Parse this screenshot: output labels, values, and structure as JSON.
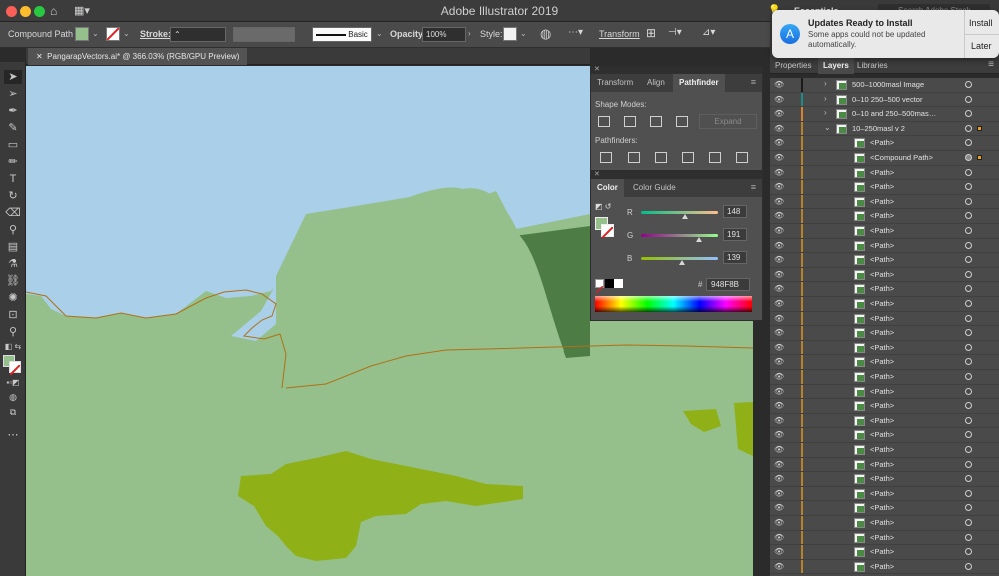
{
  "app": {
    "title": "Adobe Illustrator 2019"
  },
  "workspace": {
    "label": "Essentials"
  },
  "search": {
    "placeholder": "Search Adobe Stock"
  },
  "control_bar": {
    "selection_type": "Compound Path",
    "fill_color": "#95c08b",
    "stroke_label": "Stroke:",
    "brush_label": "Basic",
    "opacity_label": "Opacity:",
    "opacity_value": "100%",
    "style_label": "Style:",
    "transform_label": "Transform"
  },
  "document_tab": {
    "label": "PangarapVectors.ai* @ 366.03% (RGB/GPU Preview)"
  },
  "pathfinder_panel": {
    "tabs": [
      "Transform",
      "Align",
      "Pathfinder"
    ],
    "active_tab": "Pathfinder",
    "shape_modes_label": "Shape Modes:",
    "expand_label": "Expand",
    "pathfinders_label": "Pathfinders:"
  },
  "color_panel": {
    "tabs": [
      "Color",
      "Color Guide"
    ],
    "active_tab": "Color",
    "r_label": "R",
    "r_value": "148",
    "g_label": "G",
    "g_value": "191",
    "b_label": "B",
    "b_value": "139",
    "hex_prefix": "#",
    "hex_value": "948F8B",
    "swatch_color": "#95c08b"
  },
  "notification": {
    "title": "Updates Ready to Install",
    "body": "Some apps could not be updated automatically.",
    "install_label": "Install",
    "later_label": "Later"
  },
  "layers_panel": {
    "tabs": [
      "Properties",
      "Layers",
      "Libraries"
    ],
    "active_tab": "Layers",
    "rows": [
      {
        "name": "500–1000masl Image",
        "color": "#1a1a1a",
        "arrow": "›"
      },
      {
        "name": "0–10 250–500 vector",
        "color": "#1f8a8a",
        "arrow": "›"
      },
      {
        "name": "0–10 and 250–500mas…",
        "color": "#d9822b",
        "arrow": "›"
      },
      {
        "name": "10–250masl v 2",
        "color": "#b8822b",
        "arrow": "⌄"
      },
      {
        "name": "<Path>"
      },
      {
        "name": "<Compound Path>"
      },
      {
        "name": "<Path>"
      },
      {
        "name": "<Path>"
      },
      {
        "name": "<Path>"
      },
      {
        "name": "<Path>"
      },
      {
        "name": "<Path>"
      },
      {
        "name": "<Path>"
      },
      {
        "name": "<Path>"
      },
      {
        "name": "<Path>"
      },
      {
        "name": "<Path>"
      },
      {
        "name": "<Path>"
      },
      {
        "name": "<Path>"
      },
      {
        "name": "<Path>"
      },
      {
        "name": "<Path>"
      },
      {
        "name": "<Path>"
      },
      {
        "name": "<Path>"
      },
      {
        "name": "<Path>"
      },
      {
        "name": "<Path>"
      },
      {
        "name": "<Path>"
      },
      {
        "name": "<Path>"
      },
      {
        "name": "<Path>"
      },
      {
        "name": "<Path>"
      },
      {
        "name": "<Path>"
      },
      {
        "name": "<Path>"
      },
      {
        "name": "<Path>"
      },
      {
        "name": "<Path>"
      },
      {
        "name": "<Path>"
      },
      {
        "name": "<Path>"
      },
      {
        "name": "<Path>"
      }
    ]
  },
  "colors": {
    "sky": "#a9cfe9",
    "light_land": "#95c08b",
    "dark_land": "#4d7d45",
    "olive": "#8fb016",
    "path_stroke": "#b07014"
  }
}
